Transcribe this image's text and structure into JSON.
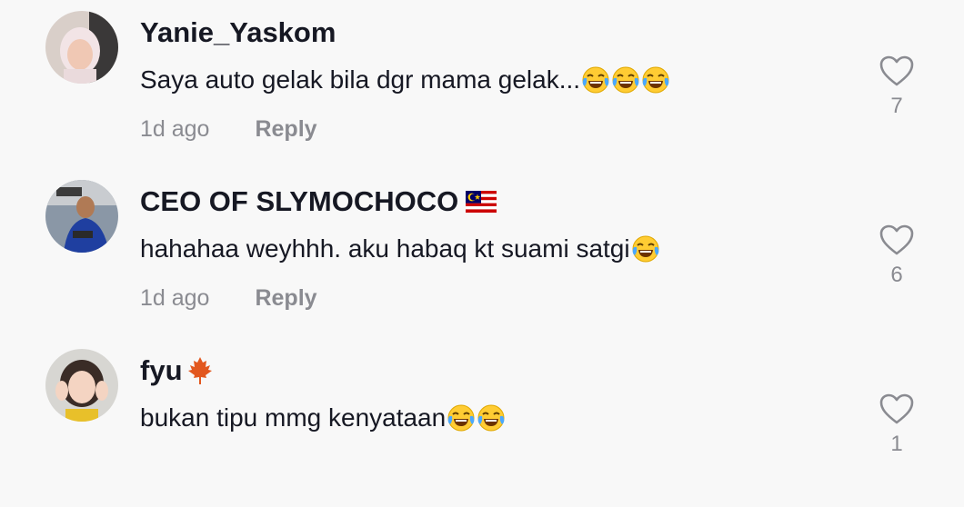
{
  "comments": [
    {
      "username": "Yanie_Yaskom",
      "text": "Saya auto gelak bila dgr mama gelak...",
      "emojis": [
        "face-with-tears-of-joy",
        "face-with-tears-of-joy",
        "face-with-tears-of-joy"
      ],
      "time": "1d ago",
      "reply": "Reply",
      "likes": "7"
    },
    {
      "username": "CEO OF SLYMOCHOCO",
      "username_icon": "malaysia-flag",
      "text": "hahahaa weyhhh. aku habaq kt suami satgi",
      "emojis": [
        "face-with-tears-of-joy"
      ],
      "time": "1d ago",
      "reply": "Reply",
      "likes": "6"
    },
    {
      "username": "fyu",
      "username_icon": "maple-leaf",
      "text": "bukan tipu mmg kenyataan",
      "emojis": [
        "face-with-tears-of-joy",
        "face-with-tears-of-joy"
      ],
      "likes": "1"
    }
  ],
  "colors": {
    "background": "#f8f8f8",
    "text": "#161823",
    "muted": "#8a8b91"
  }
}
